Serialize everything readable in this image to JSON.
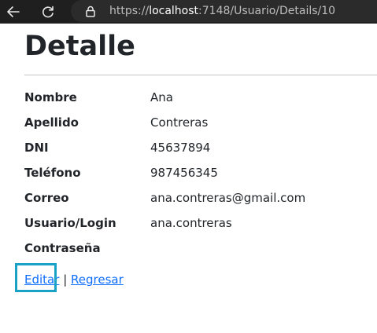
{
  "browser": {
    "url_prefix": "https://",
    "url_host": "localhost",
    "url_path": ":7148/Usuario/Details/10",
    "bar_color": "#1f1f1f"
  },
  "page": {
    "title": "Detalle"
  },
  "details": {
    "fields": [
      {
        "label": "Nombre",
        "value": "Ana"
      },
      {
        "label": "Apellido",
        "value": "Contreras"
      },
      {
        "label": "DNI",
        "value": "45637894"
      },
      {
        "label": "Teléfono",
        "value": "987456345"
      },
      {
        "label": "Correo",
        "value": "ana.contreras@gmail.com"
      },
      {
        "label": "Usuario/Login",
        "value": "ana.contreras"
      },
      {
        "label": "Contraseña",
        "value": ""
      }
    ]
  },
  "actions": {
    "edit_label": "Editar",
    "separator": "|",
    "back_label": "Regresar",
    "link_color": "#0d6efd",
    "highlight_color": "#1aa1c6"
  }
}
